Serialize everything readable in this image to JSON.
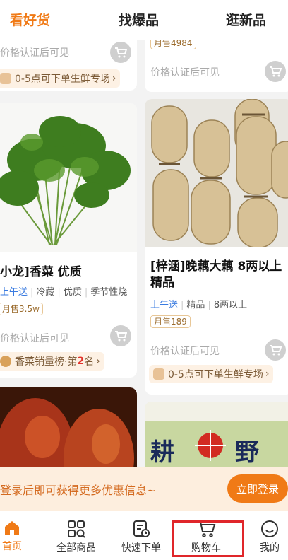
{
  "tabs": [
    {
      "label": "看好货",
      "active": true
    },
    {
      "label": "找爆品",
      "active": false
    },
    {
      "label": "逛新品",
      "active": false
    }
  ],
  "cards": {
    "top_left": {
      "price_text": "价格认证后可见",
      "promo": "0-5点可下单生鲜专场",
      "promo_arrow": "›"
    },
    "top_right": {
      "sold": "月售4984",
      "price_text": "价格认证后可见"
    },
    "cilantro": {
      "title": "小龙]香菜 优质",
      "tags": [
        "上午送",
        "冷藏",
        "优质",
        "季节性烧"
      ],
      "sold": "月售3.5w",
      "price_text": "价格认证后可见",
      "promo_prefix": "香菜销量榜·第",
      "promo_rank": "2",
      "promo_suffix": "名",
      "promo_arrow": "›"
    },
    "lotus": {
      "title": "[梓涵]晚藕大藕 8两以上精品",
      "tags": [
        "上午送",
        "精品",
        "8两以上"
      ],
      "sold": "月售189",
      "price_text": "价格认证后可见",
      "promo": "0-5点可下单生鲜专场",
      "promo_arrow": "›"
    },
    "duck": {},
    "cabbage": {
      "label_left": "耕",
      "label_right": "野"
    }
  },
  "login_bar": {
    "text": "登录后即可获得更多优惠信息~",
    "button": "立即登录"
  },
  "nav": [
    {
      "label": "首页",
      "icon": "home-icon",
      "active": true
    },
    {
      "label": "全部商品",
      "icon": "grid-search-icon",
      "active": false
    },
    {
      "label": "快速下单",
      "icon": "clock-list-icon",
      "active": false
    },
    {
      "label": "购物车",
      "icon": "cart-icon",
      "active": false
    },
    {
      "label": "我的",
      "icon": "smile-icon",
      "active": false
    }
  ],
  "colors": {
    "accent": "#f07a16",
    "highlight": "#e0262a",
    "link": "#3a7be0"
  }
}
